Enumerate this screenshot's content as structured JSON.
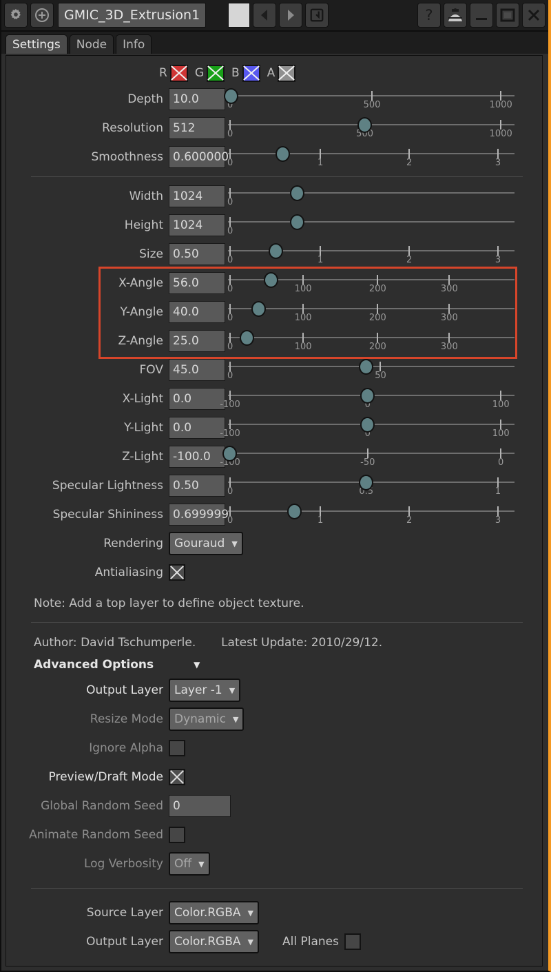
{
  "titlebar": {
    "node_name": "GMIC_3D_Extrusion1",
    "buttons": [
      {
        "name": "settings-gear-button",
        "icon": "gear-icon"
      },
      {
        "name": "add-node-button",
        "icon": "plus-circle-icon"
      },
      {
        "name": "color-swatch-button",
        "icon": "color-swatch"
      },
      {
        "name": "previous-button",
        "icon": "chevron-left-icon",
        "label": "<"
      },
      {
        "name": "next-button",
        "icon": "chevron-right-icon",
        "label": ">"
      },
      {
        "name": "revert-button",
        "icon": "undo-arrow-icon"
      },
      {
        "name": "help-button",
        "icon": "question-mark-icon",
        "label": "?"
      },
      {
        "name": "presets-button",
        "icon": "detective-hat-icon"
      },
      {
        "name": "minimize-button",
        "icon": "minimize-icon"
      },
      {
        "name": "maximize-button",
        "icon": "maximize-icon"
      },
      {
        "name": "close-button",
        "icon": "close-x-icon",
        "label": "✕"
      }
    ]
  },
  "tabs": [
    {
      "label": "Settings",
      "active": true
    },
    {
      "label": "Node",
      "active": false
    },
    {
      "label": "Info",
      "active": false
    }
  ],
  "channels": [
    {
      "key": "R",
      "color": "#d03535",
      "checked": true
    },
    {
      "key": "G",
      "color": "#18a018",
      "checked": true
    },
    {
      "key": "B",
      "color": "#5858ef",
      "checked": true
    },
    {
      "key": "A",
      "color": "#8f8f8f",
      "checked": true
    }
  ],
  "params_group1": [
    {
      "label": "Depth",
      "value": "10.0",
      "handle_pct": 1.0,
      "ticks": [
        {
          "pos": 0.5,
          "label": "0"
        },
        {
          "pos": 50,
          "label": "500"
        },
        {
          "pos": 95,
          "label": "1000"
        }
      ]
    },
    {
      "label": "Resolution",
      "value": "512",
      "handle_pct": 47.5,
      "ticks": [
        {
          "pos": 0.5,
          "label": "0"
        },
        {
          "pos": 47.5,
          "label": "500"
        },
        {
          "pos": 95,
          "label": "1000"
        }
      ]
    },
    {
      "label": "Smoothness",
      "value": "0.600000",
      "handle_pct": 19.0,
      "ticks": [
        {
          "pos": 0.5,
          "label": "0"
        },
        {
          "pos": 32,
          "label": "1"
        },
        {
          "pos": 63,
          "label": "2"
        },
        {
          "pos": 94,
          "label": "3"
        }
      ]
    }
  ],
  "params_group2": [
    {
      "label": "Width",
      "value": "1024",
      "handle_pct": 24.0,
      "ticks": [
        {
          "pos": 0.5,
          "label": "0"
        }
      ]
    },
    {
      "label": "Height",
      "value": "1024",
      "handle_pct": 24.0,
      "ticks": [
        {
          "pos": 0.5,
          "label": "0"
        }
      ]
    },
    {
      "label": "Size",
      "value": "0.50",
      "handle_pct": 16.5,
      "ticks": [
        {
          "pos": 0.5,
          "label": "0"
        },
        {
          "pos": 32,
          "label": "1"
        },
        {
          "pos": 63,
          "label": "2"
        },
        {
          "pos": 94,
          "label": "3"
        }
      ]
    }
  ],
  "params_angles": [
    {
      "label": "X-Angle",
      "value": "56.0",
      "handle_pct": 15.0,
      "ticks": [
        {
          "pos": 0.5,
          "label": "0"
        },
        {
          "pos": 26,
          "label": "100"
        },
        {
          "pos": 52,
          "label": "200"
        },
        {
          "pos": 77,
          "label": "300"
        }
      ]
    },
    {
      "label": "Y-Angle",
      "value": "40.0",
      "handle_pct": 10.5,
      "ticks": [
        {
          "pos": 0.5,
          "label": "0"
        },
        {
          "pos": 26,
          "label": "100"
        },
        {
          "pos": 52,
          "label": "200"
        },
        {
          "pos": 77,
          "label": "300"
        }
      ]
    },
    {
      "label": "Z-Angle",
      "value": "25.0",
      "handle_pct": 6.5,
      "ticks": [
        {
          "pos": 0.5,
          "label": "0"
        },
        {
          "pos": 26,
          "label": "100"
        },
        {
          "pos": 52,
          "label": "200"
        },
        {
          "pos": 77,
          "label": "300"
        }
      ]
    }
  ],
  "params_group3": [
    {
      "label": "FOV",
      "value": "45.0",
      "handle_pct": 48.0,
      "ticks": [
        {
          "pos": 0.5,
          "label": "0"
        },
        {
          "pos": 53,
          "label": "50"
        }
      ]
    },
    {
      "label": "X-Light",
      "value": "0.0",
      "handle_pct": 48.5,
      "ticks": [
        {
          "pos": 0.5,
          "label": "-100"
        },
        {
          "pos": 48.5,
          "label": "0"
        },
        {
          "pos": 95,
          "label": "100"
        }
      ]
    },
    {
      "label": "Y-Light",
      "value": "0.0",
      "handle_pct": 48.5,
      "ticks": [
        {
          "pos": 0.5,
          "label": "-100"
        },
        {
          "pos": 48.5,
          "label": "0"
        },
        {
          "pos": 95,
          "label": "100"
        }
      ]
    },
    {
      "label": "Z-Light",
      "value": "-100.0",
      "handle_pct": 0.5,
      "ticks": [
        {
          "pos": 0.5,
          "label": "-100"
        },
        {
          "pos": 48.5,
          "label": "-50"
        },
        {
          "pos": 95,
          "label": "0"
        }
      ]
    },
    {
      "label": "Specular Lightness",
      "value": "0.50",
      "handle_pct": 48.0,
      "ticks": [
        {
          "pos": 0.5,
          "label": "0"
        },
        {
          "pos": 48,
          "label": "0.5"
        },
        {
          "pos": 94,
          "label": "1"
        }
      ]
    },
    {
      "label": "Specular Shininess",
      "value": "0.699999",
      "handle_pct": 23.0,
      "ticks": [
        {
          "pos": 0.5,
          "label": "0"
        },
        {
          "pos": 32,
          "label": "1"
        },
        {
          "pos": 63,
          "label": "2"
        },
        {
          "pos": 94,
          "label": "3"
        }
      ]
    }
  ],
  "rendering": {
    "label": "Rendering",
    "value": "Gouraud"
  },
  "antialiasing": {
    "label": "Antialiasing",
    "checked": true
  },
  "note": "Note: Add a top layer to define object texture.",
  "author": "Author: David Tschumperle.",
  "latest_update": "Latest Update: 2010/29/12.",
  "advanced": {
    "label": "Advanced Options",
    "caret": "▼"
  },
  "advanced_rows": {
    "output_layer": {
      "label": "Output Layer",
      "value": "Layer -1"
    },
    "resize_mode": {
      "label": "Resize Mode",
      "value": "Dynamic"
    },
    "ignore_alpha": {
      "label": "Ignore Alpha",
      "checked": false
    },
    "preview_draft": {
      "label": "Preview/Draft Mode",
      "checked": true
    },
    "global_random_seed": {
      "label": "Global Random Seed",
      "value": "0"
    },
    "animate_random_seed": {
      "label": "Animate Random Seed",
      "checked": false
    },
    "log_verbosity": {
      "label": "Log Verbosity",
      "value": "Off"
    }
  },
  "footer": {
    "source_layer": {
      "label": "Source Layer",
      "value": "Color.RGBA"
    },
    "output_layer": {
      "label": "Output Layer",
      "value": "Color.RGBA"
    },
    "all_planes": {
      "label": "All Planes",
      "checked": false
    }
  },
  "colors": {
    "highlight": "#d7452a",
    "accent": "#f59a23",
    "handle": "#5f8184"
  }
}
